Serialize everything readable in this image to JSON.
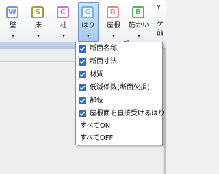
{
  "ribbon": {
    "group_label": "部",
    "buttons": [
      {
        "letter": "W",
        "label": "壁",
        "arrow": "▾",
        "color": "#7b8ff0"
      },
      {
        "letter": "S",
        "label": "床",
        "arrow": "▾",
        "color": "#9aa43a"
      },
      {
        "letter": "C",
        "label": "柱",
        "arrow": "▾",
        "color": "#d06ad8"
      },
      {
        "letter": "G",
        "label": "はり",
        "arrow": "▾",
        "color": "#67b8e4"
      },
      {
        "letter": "R",
        "label": "屋根",
        "arrow": "▾",
        "color": "#e8888e"
      },
      {
        "letter": "B",
        "label": "筋かい",
        "arrow": "▾",
        "color": "#54b85a"
      }
    ],
    "right_clip": {
      "line1": "Y",
      "line2": "ケ",
      "line3": "前"
    }
  },
  "menu": {
    "items": [
      {
        "label": "断面名称",
        "checked": true
      },
      {
        "label": "断面寸法",
        "checked": true
      },
      {
        "label": "材質",
        "checked": true
      },
      {
        "label": "低減係数(断面欠損)",
        "checked": true
      },
      {
        "label": "部位",
        "checked": true
      },
      {
        "label": "屋根面を直接受けるはり",
        "checked": true
      }
    ],
    "all_on": "すべてON",
    "all_off": "すべてOFF"
  },
  "colors": {
    "checkbox": "#2f6ec2",
    "active_button": "#a9c9ee"
  }
}
